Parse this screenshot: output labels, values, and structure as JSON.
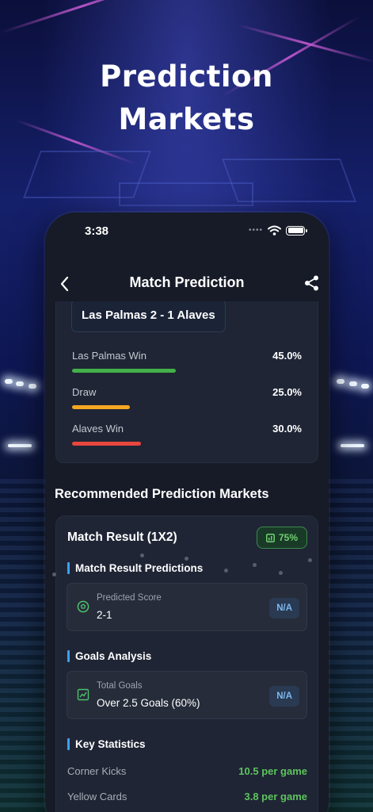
{
  "hero": {
    "line1": "Prediction",
    "line2": "Markets"
  },
  "status_bar": {
    "time": "3:38"
  },
  "nav": {
    "title": "Match Prediction"
  },
  "match": {
    "score_line": "Las Palmas 2 - 1 Alaves",
    "probabilities": [
      {
        "label": "Las Palmas Win",
        "value": "45.0%",
        "fraction": 0.45,
        "color": "#43b04a"
      },
      {
        "label": "Draw",
        "value": "25.0%",
        "fraction": 0.25,
        "color": "#f5a623"
      },
      {
        "label": "Alaves Win",
        "value": "30.0%",
        "fraction": 0.3,
        "color": "#e9463d"
      }
    ]
  },
  "recommended": {
    "title": "Recommended Prediction Markets",
    "market": {
      "title": "Match Result (1X2)",
      "confidence": "75%",
      "match_result_heading": "Match Result Predictions",
      "predicted_score": {
        "label": "Predicted Score",
        "value": "2-1",
        "badge": "N/A"
      },
      "goals_heading": "Goals Analysis",
      "total_goals": {
        "label": "Total Goals",
        "value": "Over 2.5 Goals (60%)",
        "badge": "N/A"
      },
      "key_stats_heading": "Key Statistics",
      "stats": [
        {
          "label": "Corner Kicks",
          "value": "10.5 per game"
        },
        {
          "label": "Yellow Cards",
          "value": "3.8 per game"
        }
      ]
    }
  },
  "icons": {
    "back": "chevron-left-icon",
    "share": "share-icon",
    "wifi": "wifi-icon",
    "battery": "battery-icon",
    "soccer_ball": "soccer-ball-icon",
    "goals_chart": "chart-icon",
    "confidence": "confidence-icon"
  },
  "colors": {
    "accent": "#3aa0ff",
    "positive": "#5cc45c",
    "badge_blue": "#7db8f0"
  }
}
